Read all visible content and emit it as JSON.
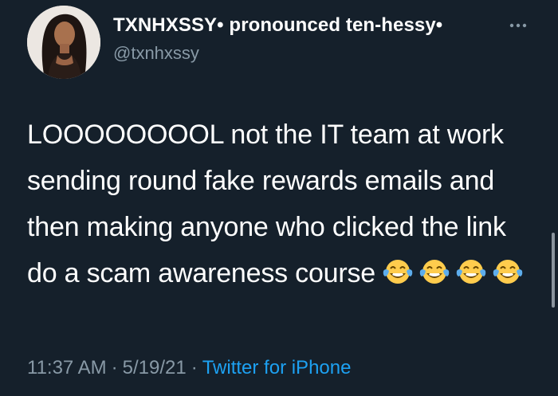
{
  "tweet": {
    "display_name": "TXNHXSSY• pronounced ten-hessy•",
    "handle": "@txnhxssy",
    "text": "LOOOOOOOOL not the IT team at work sending round fake rewards emails and then making anyone who clicked the link do a scam awareness course",
    "emojis": [
      "face-with-tears-of-joy",
      "face-with-tears-of-joy",
      "face-with-tears-of-joy",
      "face-with-tears-of-joy"
    ],
    "time": "11:37 AM",
    "date": "5/19/21",
    "separator": "·",
    "source": "Twitter for iPhone"
  },
  "icons": {
    "more": "more-horizontal-icon",
    "avatar": "profile-photo"
  },
  "colors": {
    "background": "#15202b",
    "primary_text": "#ffffff",
    "secondary_text": "#8899a6",
    "link": "#1da1f2"
  }
}
